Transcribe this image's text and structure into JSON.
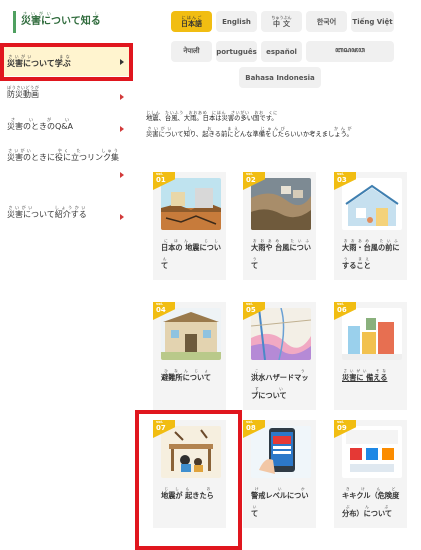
{
  "sidebar": {
    "title": {
      "base": "災害について知る",
      "ruby": "さいがい　　　　　し"
    },
    "items": [
      {
        "label": "災害について学ぶ",
        "ruby": "さいがい　　　　まな",
        "active": true
      },
      {
        "label": "防災動画",
        "ruby": "ぼうさいどうが",
        "active": false
      },
      {
        "label": "災害のときのQ&A",
        "ruby": "さいがい",
        "active": false
      },
      {
        "label": "災害のときに役に立つリンク集",
        "ruby": "さいがい　　　　やく　た　　　しゅう",
        "active": false
      },
      {
        "label": "災害について紹介する",
        "ruby": "さいがい　　　しょうかい",
        "active": false
      }
    ]
  },
  "languages": [
    {
      "label": "日本語",
      "ruby": "にほんご",
      "active": true
    },
    {
      "label": "English",
      "active": false
    },
    {
      "label": "中文",
      "ruby": "ちゅうぶん",
      "active": false
    },
    {
      "label": "한국어",
      "active": false
    },
    {
      "label": "Tiếng Việt",
      "active": false
    },
    {
      "label": "नेपाली",
      "active": false
    },
    {
      "label": "português",
      "active": false
    },
    {
      "label": "español",
      "active": false
    },
    {
      "label": "ꦧꦱꦗꦮ",
      "active": false
    },
    {
      "label": "Bahasa Indonesia",
      "active": false
    }
  ],
  "intro": {
    "line1": "地震、台風、大雨。日本は災害の多い国です。",
    "line1_ruby": "じしん　たいふう　おおあめ　にほん　さいがい　おお　くに",
    "line2": "災害について知り、起きる前にどんな準備をしたらいいか考えましょう。",
    "line2_ruby": "さいがい　　し　　お　　まえ　　　じゅんび　　　　　　　かんが"
  },
  "cards": [
    {
      "vol": "vol.",
      "num": "01",
      "title": "日本の 地震について",
      "ruby": "にほん　じしん"
    },
    {
      "vol": "vol.",
      "num": "02",
      "title": "大雨や 台風について",
      "ruby": "おおあめ　たいふう"
    },
    {
      "vol": "vol.",
      "num": "03",
      "title": "大雨・台風の前に すること",
      "ruby": "おおあめ　たいふう　まえ"
    },
    {
      "vol": "vol.",
      "num": "04",
      "title": "避難所について",
      "ruby": "ひなんじょ"
    },
    {
      "vol": "vol.",
      "num": "05",
      "title": "洪水ハザードマップについて",
      "ruby": "こうずい"
    },
    {
      "vol": "vol.",
      "num": "06",
      "title": "災害に 備える",
      "ruby": "さいがい　そな"
    },
    {
      "vol": "vol.",
      "num": "07",
      "title": "地震が 起きたら",
      "ruby": "じしん　お"
    },
    {
      "vol": "vol.",
      "num": "08",
      "title": "警戒レベルについて",
      "ruby": "けいかい"
    },
    {
      "vol": "vol.",
      "num": "09",
      "title": "キキクル（危険度分布）について",
      "ruby": "きけんど　ぶんぷ"
    }
  ],
  "colors": {
    "accent": "#f1bd12",
    "highlight": "#e0161e",
    "green": "#4fa060"
  }
}
